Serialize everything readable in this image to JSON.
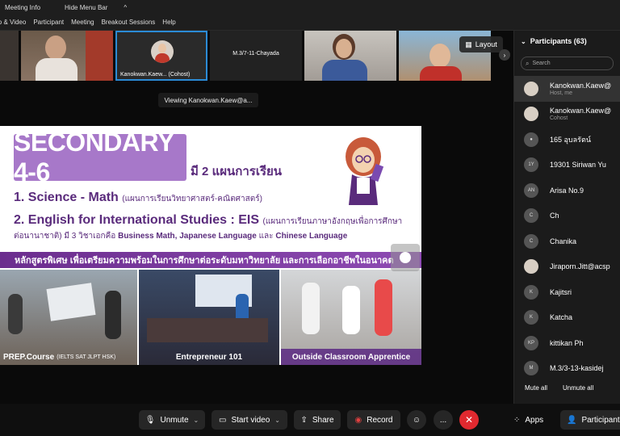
{
  "topbar": {
    "meeting_info": "Meeting Info",
    "hide_menu": "Hide Menu Bar",
    "chevron": "^"
  },
  "menu": [
    "io & Video",
    "Participant",
    "Meeting",
    "Breakout Sessions",
    "Help"
  ],
  "thumbnails": {
    "cohost_name": "Kanokwan.Kaew...",
    "cohost_role": "(Cohost)",
    "middle_name": "M.3/7-11-Chayada"
  },
  "layout_label": "Layout",
  "viewing_label": "Viewing Kanokwan.Kaew@a...",
  "slide": {
    "title": "SECONDARY 4-6",
    "plans": "มี 2 แผนการเรียน",
    "line1_main": "1. Science - Math",
    "line1_sub": "(แผนการเรียนวิทยาศาสตร์-คณิตศาสตร์)",
    "line2_main": "2. English for International Studies : EIS",
    "line2_sub": "(แผนการเรียนภาษาอังกฤษเพื่อการศึกษา",
    "line3_a": "ต่อนานาชาติ) มี 3 วิชาเอกคือ",
    "line3_b": "Business Math,",
    "line3_c": "Japanese Language",
    "line3_d": "และ",
    "line3_e": "Chinese Language",
    "banner": "หลักสูตรพิเศษ เพื่อเตรียมความพร้อมในการศึกษาต่อระดับมหาวิทยาลัย และการเลือกอาชีพในอนาคต",
    "photo1_caption": "PREP.Course",
    "photo1_small": "(IELTS SAT JLPT HSK)",
    "photo2_caption": "Entrepreneur 101",
    "photo3_caption": "Outside Classroom Apprentice"
  },
  "participants": {
    "title": "Participants (63)",
    "search_placeholder": "Search",
    "items": [
      {
        "initials": "",
        "name": "Kanokwan.Kaew@",
        "role": "Host, me"
      },
      {
        "initials": "",
        "name": "Kanokwan.Kaew@",
        "role": "Cohost"
      },
      {
        "initials": "",
        "name": "165 อุบลรัตน์",
        "role": ""
      },
      {
        "initials": "1Y",
        "name": "19301 Siriwan Yu",
        "role": ""
      },
      {
        "initials": "AN",
        "name": "Arisa No.9",
        "role": ""
      },
      {
        "initials": "C",
        "name": "Ch",
        "role": ""
      },
      {
        "initials": "C",
        "name": "Chanika",
        "role": ""
      },
      {
        "initials": "",
        "name": "Jiraporn.Jitt@acsp",
        "role": ""
      },
      {
        "initials": "K",
        "name": "Kajitsri",
        "role": ""
      },
      {
        "initials": "K",
        "name": "Katcha",
        "role": ""
      },
      {
        "initials": "KP",
        "name": "kittikan Ph",
        "role": ""
      },
      {
        "initials": "M",
        "name": "M.3/3-13-kasidej",
        "role": ""
      }
    ],
    "mute_all": "Mute all",
    "unmute_all": "Unmute all"
  },
  "toolbar": {
    "unmute": "Unmute",
    "start_video": "Start video",
    "share": "Share",
    "record": "Record",
    "apps": "Apps",
    "participants": "Participants",
    "more": "...",
    "end": "✕"
  }
}
